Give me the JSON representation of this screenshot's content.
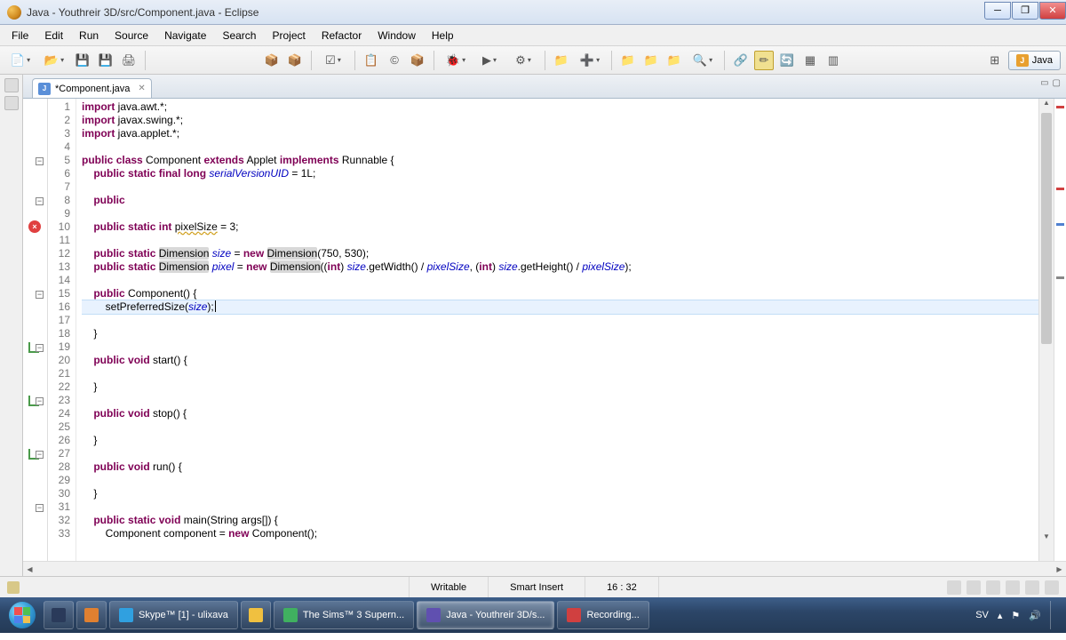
{
  "window": {
    "title": "Java - Youthreir 3D/src/Component.java - Eclipse"
  },
  "menu": [
    "File",
    "Edit",
    "Run",
    "Source",
    "Navigate",
    "Search",
    "Project",
    "Refactor",
    "Window",
    "Help"
  ],
  "perspective": {
    "label": "Java"
  },
  "editor": {
    "tab_label": "*Component.java",
    "highlight_line": 16,
    "cursor": "16 : 32",
    "code_lines": [
      {
        "n": 1,
        "tokens": [
          [
            "kw",
            "import"
          ],
          [
            "",
            " java.awt.*;"
          ]
        ]
      },
      {
        "n": 2,
        "tokens": [
          [
            "kw",
            "import"
          ],
          [
            "",
            " javax.swing.*;"
          ]
        ]
      },
      {
        "n": 3,
        "tokens": [
          [
            "kw",
            "import"
          ],
          [
            "",
            " java.applet.*;"
          ]
        ]
      },
      {
        "n": 4,
        "tokens": []
      },
      {
        "n": 5,
        "tokens": [
          [
            "kw",
            "public"
          ],
          [
            "",
            " "
          ],
          [
            "kw",
            "class"
          ],
          [
            "",
            " Component "
          ],
          [
            "kw",
            "extends"
          ],
          [
            "",
            " Applet "
          ],
          [
            "kw",
            "implements"
          ],
          [
            "",
            " Runnable {"
          ]
        ],
        "fold": "minus"
      },
      {
        "n": 6,
        "tokens": [
          [
            "",
            "    "
          ],
          [
            "kw",
            "public"
          ],
          [
            "",
            " "
          ],
          [
            "kw",
            "static"
          ],
          [
            "",
            " "
          ],
          [
            "kw",
            "final"
          ],
          [
            "",
            " "
          ],
          [
            "kw",
            "long"
          ],
          [
            "",
            " "
          ],
          [
            "field",
            "serialVersionUID"
          ],
          [
            "",
            " = 1L;"
          ]
        ]
      },
      {
        "n": 7,
        "tokens": []
      },
      {
        "n": 8,
        "tokens": [
          [
            "",
            "    "
          ],
          [
            "kw",
            "public"
          ]
        ],
        "fold": "minus"
      },
      {
        "n": 9,
        "tokens": []
      },
      {
        "n": 10,
        "err": true,
        "tokens": [
          [
            "",
            "    "
          ],
          [
            "kw",
            "public"
          ],
          [
            "",
            " "
          ],
          [
            "kw",
            "static"
          ],
          [
            "",
            " "
          ],
          [
            "kw",
            "int"
          ],
          [
            "",
            " "
          ],
          [
            "underline",
            "pixelSize"
          ],
          [
            "",
            " = 3;"
          ]
        ]
      },
      {
        "n": 11,
        "tokens": []
      },
      {
        "n": 12,
        "tokens": [
          [
            "",
            "    "
          ],
          [
            "kw",
            "public"
          ],
          [
            "",
            " "
          ],
          [
            "kw",
            "static"
          ],
          [
            "",
            " "
          ],
          [
            "sq",
            "Dimension"
          ],
          [
            "",
            " "
          ],
          [
            "field",
            "size"
          ],
          [
            "",
            " = "
          ],
          [
            "kw",
            "new"
          ],
          [
            "",
            " "
          ],
          [
            "sq",
            "Dimension"
          ],
          [
            "",
            "(750, 530);"
          ]
        ]
      },
      {
        "n": 13,
        "tokens": [
          [
            "",
            "    "
          ],
          [
            "kw",
            "public"
          ],
          [
            "",
            " "
          ],
          [
            "kw",
            "static"
          ],
          [
            "",
            " "
          ],
          [
            "sq",
            "Dimension"
          ],
          [
            "",
            " "
          ],
          [
            "field",
            "pixel"
          ],
          [
            "",
            " = "
          ],
          [
            "kw",
            "new"
          ],
          [
            "",
            " "
          ],
          [
            "sq",
            "Dimension"
          ],
          [
            "",
            "(("
          ],
          [
            "kw",
            "int"
          ],
          [
            "",
            ") "
          ],
          [
            "field",
            "size"
          ],
          [
            "",
            ".getWidth() / "
          ],
          [
            "field",
            "pixelSize"
          ],
          [
            "",
            ", ("
          ],
          [
            "kw",
            "int"
          ],
          [
            "",
            ") "
          ],
          [
            "field",
            "size"
          ],
          [
            "",
            ".getHeight() / "
          ],
          [
            "field",
            "pixelSize"
          ],
          [
            "",
            ");"
          ]
        ]
      },
      {
        "n": 14,
        "tokens": []
      },
      {
        "n": 15,
        "tokens": [
          [
            "",
            "    "
          ],
          [
            "kw",
            "public"
          ],
          [
            "",
            " Component() {"
          ]
        ],
        "fold": "minus"
      },
      {
        "n": 16,
        "tokens": [
          [
            "",
            "        setPreferredSize("
          ],
          [
            "field",
            "size"
          ],
          [
            "",
            ");"
          ]
        ],
        "cursor": true
      },
      {
        "n": 17,
        "tokens": [
          [
            "",
            "    }"
          ]
        ]
      },
      {
        "n": 18,
        "tokens": []
      },
      {
        "n": 19,
        "override": true,
        "tokens": [
          [
            "",
            "    "
          ],
          [
            "kw",
            "public"
          ],
          [
            "",
            " "
          ],
          [
            "kw",
            "void"
          ],
          [
            "",
            " start() {"
          ]
        ],
        "fold": "minus"
      },
      {
        "n": 20,
        "tokens": []
      },
      {
        "n": 21,
        "tokens": [
          [
            "",
            "    }"
          ]
        ]
      },
      {
        "n": 22,
        "tokens": []
      },
      {
        "n": 23,
        "override": true,
        "tokens": [
          [
            "",
            "    "
          ],
          [
            "kw",
            "public"
          ],
          [
            "",
            " "
          ],
          [
            "kw",
            "void"
          ],
          [
            "",
            " stop() {"
          ]
        ],
        "fold": "minus"
      },
      {
        "n": 24,
        "tokens": []
      },
      {
        "n": 25,
        "tokens": [
          [
            "",
            "    }"
          ]
        ]
      },
      {
        "n": 26,
        "tokens": []
      },
      {
        "n": 27,
        "override": true,
        "tokens": [
          [
            "",
            "    "
          ],
          [
            "kw",
            "public"
          ],
          [
            "",
            " "
          ],
          [
            "kw",
            "void"
          ],
          [
            "",
            " run() {"
          ]
        ],
        "fold": "minus"
      },
      {
        "n": 28,
        "tokens": []
      },
      {
        "n": 29,
        "tokens": [
          [
            "",
            "    }"
          ]
        ]
      },
      {
        "n": 30,
        "tokens": []
      },
      {
        "n": 31,
        "tokens": [
          [
            "",
            "    "
          ],
          [
            "kw",
            "public"
          ],
          [
            "",
            " "
          ],
          [
            "kw",
            "static"
          ],
          [
            "",
            " "
          ],
          [
            "kw",
            "void"
          ],
          [
            "",
            " main(String args[]) {"
          ]
        ],
        "fold": "minus"
      },
      {
        "n": 32,
        "tokens": [
          [
            "",
            "        Component component = "
          ],
          [
            "kw",
            "new"
          ],
          [
            "",
            " Component();"
          ]
        ]
      },
      {
        "n": 33,
        "tokens": []
      }
    ]
  },
  "status": {
    "writable": "Writable",
    "insert": "Smart Insert",
    "pos": "16 : 32"
  },
  "taskbar": {
    "items": [
      {
        "label": "",
        "color": "#2a3a5a",
        "icononly": true
      },
      {
        "label": "",
        "color": "#e08030",
        "icononly": true
      },
      {
        "label": "Skype™ [1] - ulixava",
        "color": "#30a0e0"
      },
      {
        "label": "",
        "color": "#f0c040",
        "icononly": true
      },
      {
        "label": "The Sims™ 3 Supern...",
        "color": "#40b060"
      },
      {
        "label": "Java - Youthreir 3D/s...",
        "color": "#6050b0",
        "active": true
      },
      {
        "label": "Recording...",
        "color": "#d04040"
      }
    ],
    "lang": "SV"
  }
}
